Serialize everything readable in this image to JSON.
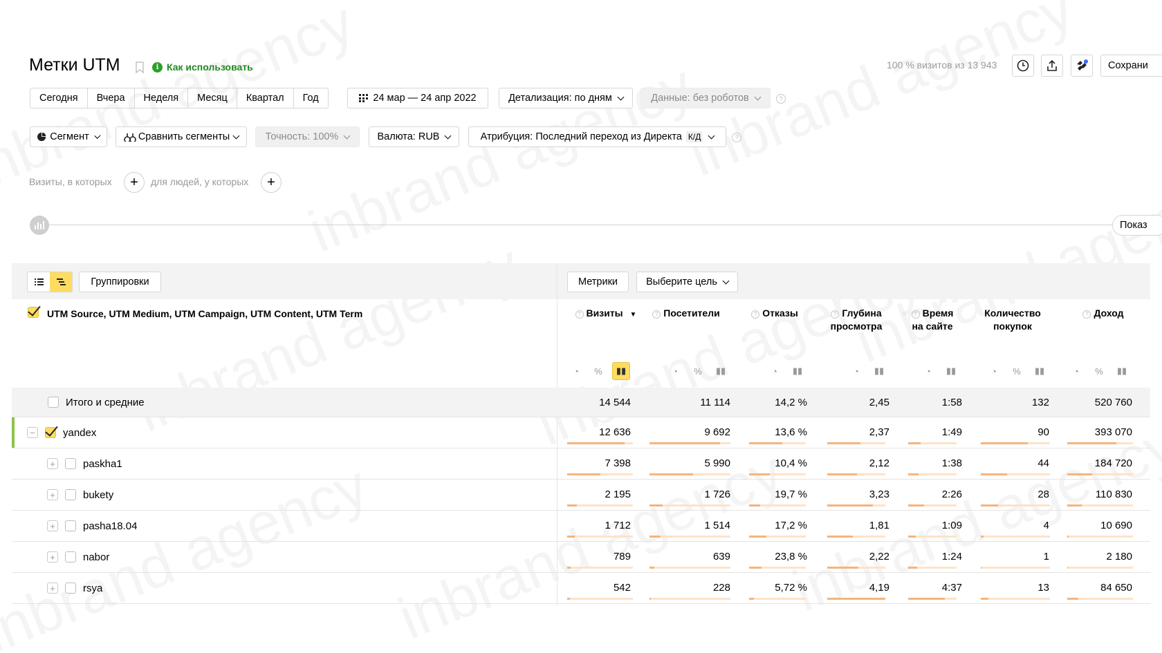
{
  "header": {
    "title": "Метки UTM",
    "how_to_use": "Как использовать",
    "visits_info": "100 % визитов из 13 943",
    "save_label": "Сохрани"
  },
  "periods": [
    "Сегодня",
    "Вчера",
    "Неделя",
    "Месяц",
    "Квартал",
    "Год"
  ],
  "date_range": "24 мар — 24 апр 2022",
  "detail": "Детализация: по дням",
  "robots": "Данные: без роботов",
  "filters": {
    "segment": "Сегмент",
    "compare": "Сравнить сегменты",
    "accuracy": "Точность: 100%",
    "currency": "Валюта: RUB",
    "attribution": "Атрибуция: Последний переход из Директа",
    "attribution_tag": "К/Д"
  },
  "conditions": {
    "visits_label": "Визиты, в которых",
    "people_label": "для людей, у которых"
  },
  "chart_show_label": "Показ",
  "toolbar": {
    "groupings": "Группировки",
    "metrics": "Метрики",
    "goal": "Выберите цель"
  },
  "dimension_header": "UTM Source, UTM Medium, UTM Campaign, UTM Content, UTM Term",
  "columns": [
    {
      "label": "Визиты",
      "sort": "▼"
    },
    {
      "label": "Посетители"
    },
    {
      "label": "Отказы"
    },
    {
      "label": "Глубина просмотра"
    },
    {
      "label": "Время на сайте"
    },
    {
      "label": "Количество покупок"
    },
    {
      "label": "Доход"
    }
  ],
  "accent_color": "#ffdc60",
  "bar_color": "#f7b37a",
  "selection_color": "#8bc34a",
  "totals": {
    "label": "Итого и средние",
    "values": [
      "14 544",
      "11 114",
      "14,2 %",
      "2,45",
      "1:58",
      "132",
      "520 760"
    ]
  },
  "rows": [
    {
      "name": "yandex",
      "level": 0,
      "checked": true,
      "values": [
        "12 636",
        "9 692",
        "13,6 %",
        "2,37",
        "1:49",
        "90",
        "393 070"
      ],
      "bars": [
        0.87,
        0.87,
        0.58,
        0.57,
        0.25,
        0.68,
        0.75
      ]
    },
    {
      "name": "paskha1",
      "level": 1,
      "checked": false,
      "values": [
        "7 398",
        "5 990",
        "10,4 %",
        "2,12",
        "1:38",
        "44",
        "184 720"
      ],
      "bars": [
        0.51,
        0.54,
        0.36,
        0.51,
        0.22,
        0.38,
        0.38
      ]
    },
    {
      "name": "bukety",
      "level": 1,
      "checked": false,
      "values": [
        "2 195",
        "1 726",
        "19,7 %",
        "3,23",
        "2:26",
        "28",
        "110 830"
      ],
      "bars": [
        0.15,
        0.16,
        0.19,
        0.78,
        0.33,
        0.25,
        0.22
      ]
    },
    {
      "name": "pasha18.04",
      "level": 1,
      "checked": false,
      "values": [
        "1 712",
        "1 514",
        "17,2 %",
        "1,81",
        "1:09",
        "4",
        "10 690"
      ],
      "bars": [
        0.12,
        0.14,
        0.3,
        0.44,
        0.16,
        0.04,
        0.02
      ]
    },
    {
      "name": "nabor",
      "level": 1,
      "checked": false,
      "values": [
        "789",
        "639",
        "23,8 %",
        "2,22",
        "1:24",
        "1",
        "2 180"
      ],
      "bars": [
        0.05,
        0.06,
        0.22,
        0.54,
        0.19,
        0.01,
        0.01
      ]
    },
    {
      "name": "rsya",
      "level": 1,
      "checked": false,
      "values": [
        "542",
        "228",
        "5,72 %",
        "4,19",
        "4:37",
        "13",
        "84 650"
      ],
      "bars": [
        0.04,
        0.02,
        0.08,
        1.0,
        0.75,
        0.11,
        0.17
      ]
    }
  ]
}
